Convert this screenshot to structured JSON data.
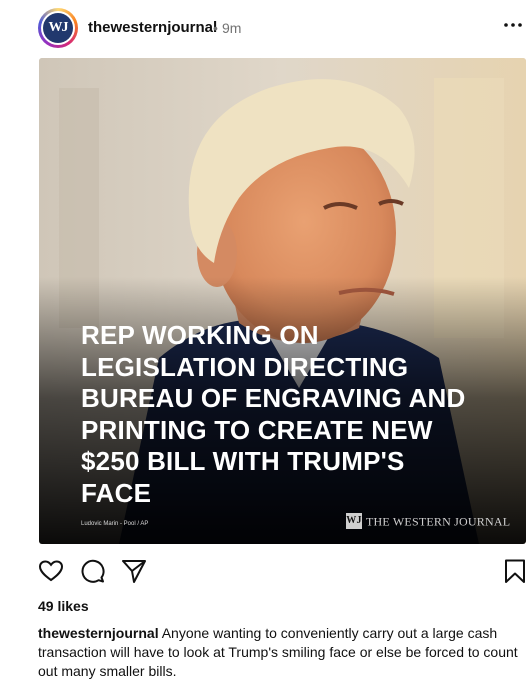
{
  "header": {
    "avatar_text": "WJ",
    "username": "thewesternjournal",
    "separator": "•",
    "time": "9m",
    "more_icon": "more-horizontal-icon"
  },
  "image": {
    "headline": "REP WORKING ON\nLEGISLATION DIRECTING\nBUREAU OF ENGRAVING AND\nPRINTING TO CREATE NEW\n$250 BILL WITH TRUMP'S\nFACE",
    "photo_credit": "Ludovic Marin - Pool / AP",
    "brand_mark": "WJ",
    "brand_name": "THE WESTERN JOURNAL"
  },
  "actions": {
    "like_icon": "heart-icon",
    "comment_icon": "comment-icon",
    "share_icon": "send-icon",
    "save_icon": "bookmark-icon"
  },
  "likes": "49 likes",
  "caption": {
    "username": "thewesternjournal",
    "text": "Anyone wanting to conveniently carry out a large cash transaction will have to look at Trump's smiling face or else be forced to count out many smaller bills."
  },
  "colors": {
    "text": "#111111",
    "muted": "#737373",
    "headline": "#ffffff"
  }
}
